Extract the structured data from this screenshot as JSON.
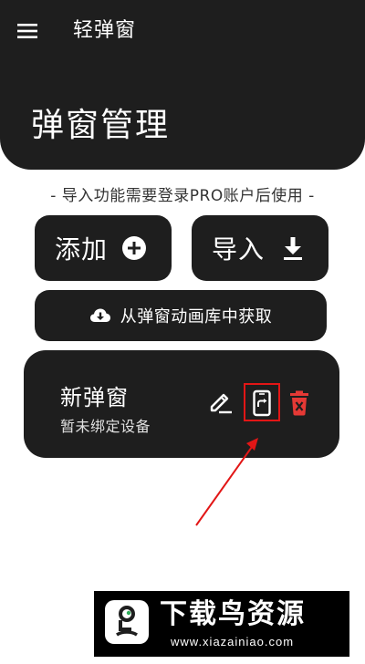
{
  "app": {
    "title": "轻弹窗",
    "menu_icon": "menu-icon"
  },
  "page": {
    "title": "弹窗管理",
    "notice": "- 导入功能需要登录PRO账户后使用 -"
  },
  "actions": {
    "add_label": "添加",
    "add_icon": "plus-circle-icon",
    "import_label": "导入",
    "import_icon": "download-icon",
    "gallery_label": "从弹窗动画库中获取",
    "gallery_icon": "cloud-download-icon"
  },
  "popup_card": {
    "title": "新弹窗",
    "subtitle": "暂未绑定设备",
    "edit_icon": "edit-icon",
    "bind_icon": "bind-device-icon",
    "delete_icon": "delete-icon"
  },
  "annotation": {
    "color": "#e21616"
  },
  "watermark": {
    "main": "下载鸟资源",
    "sub": "www.xiazainiao.com"
  },
  "colors": {
    "dark": "#1e1e1e",
    "background": "#ffffff",
    "delete": "#e53935",
    "accent_red": "#e21616"
  }
}
